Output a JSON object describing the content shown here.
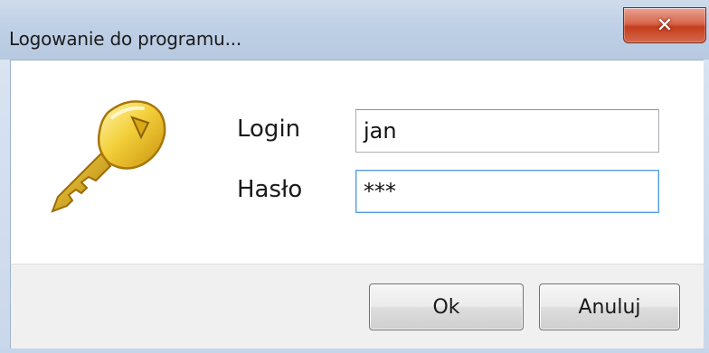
{
  "window": {
    "title": "Logowanie do programu...",
    "close_glyph": "✕"
  },
  "form": {
    "login_label": "Login",
    "login_value": "jan",
    "password_label": "Hasło",
    "password_value": "***"
  },
  "buttons": {
    "ok_label": "Ok",
    "cancel_label": "Anuluj"
  },
  "icons": {
    "key": "key-icon",
    "close": "close-icon"
  },
  "colors": {
    "title_bar": "#bfd0e6",
    "close_button": "#c43c1c",
    "focus_border": "#569de5",
    "footer": "#f0f0f0"
  }
}
